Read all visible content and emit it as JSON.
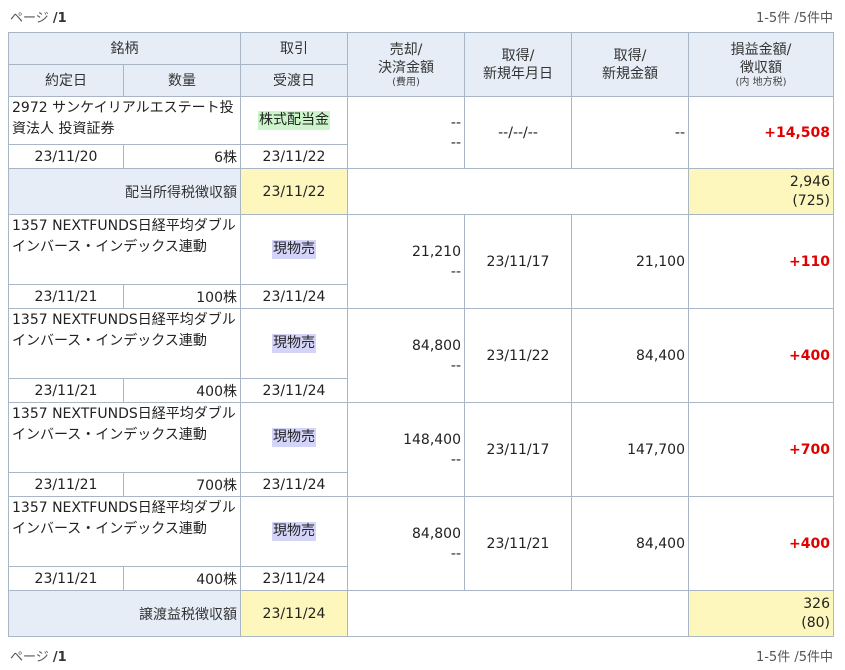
{
  "pager": {
    "page_label": "ページ",
    "page_value": "/1",
    "count_text": "1-5件 /5件中"
  },
  "headers": {
    "meigara": "銘柄",
    "torihiki": "取引",
    "baikyaku_line1": "売却/",
    "baikyaku_line2": "決済金額",
    "baikyaku_sub": "(費用)",
    "shutoku_date_line1": "取得/",
    "shutoku_date_line2": "新規年月日",
    "shutoku_amt_line1": "取得/",
    "shutoku_amt_line2": "新規金額",
    "soneki_line1": "損益金額/",
    "soneki_line2": "徴収額",
    "soneki_sub": "(内 地方税)",
    "yakujo": "約定日",
    "suryo": "数量",
    "ukewatashi": "受渡日"
  },
  "rows": [
    {
      "name": "2972 サンケイリアルエステート投資法人 投資証券",
      "type": "株式配当金",
      "type_kind": "div",
      "sale_amount": "--",
      "sale_fee": "--",
      "acq_date": "--/--/--",
      "acq_amount": "--",
      "profit": "+14,508",
      "trade_date": "23/11/20",
      "qty": "6株",
      "settle_date": "23/11/22"
    },
    {
      "tax_row": true,
      "tax_label": "配当所得税徴収額",
      "tax_date": "23/11/22",
      "tax_amount": "2,946",
      "tax_local": "(725)"
    },
    {
      "name": "1357 NEXTFUNDS日経平均ダブルインバース・インデックス連動",
      "type": "現物売",
      "sale_amount": "21,210",
      "sale_fee": "--",
      "acq_date": "23/11/17",
      "acq_amount": "21,100",
      "profit": "+110",
      "trade_date": "23/11/21",
      "qty": "100株",
      "settle_date": "23/11/24"
    },
    {
      "name": "1357 NEXTFUNDS日経平均ダブルインバース・インデックス連動",
      "type": "現物売",
      "sale_amount": "84,800",
      "sale_fee": "--",
      "acq_date": "23/11/22",
      "acq_amount": "84,400",
      "profit": "+400",
      "trade_date": "23/11/21",
      "qty": "400株",
      "settle_date": "23/11/24"
    },
    {
      "name": "1357 NEXTFUNDS日経平均ダブルインバース・インデックス連動",
      "type": "現物売",
      "sale_amount": "148,400",
      "sale_fee": "--",
      "acq_date": "23/11/17",
      "acq_amount": "147,700",
      "profit": "+700",
      "trade_date": "23/11/21",
      "qty": "700株",
      "settle_date": "23/11/24"
    },
    {
      "name": "1357 NEXTFUNDS日経平均ダブルインバース・インデックス連動",
      "type": "現物売",
      "sale_amount": "84,800",
      "sale_fee": "--",
      "acq_date": "23/11/21",
      "acq_amount": "84,400",
      "profit": "+400",
      "trade_date": "23/11/21",
      "qty": "400株",
      "settle_date": "23/11/24"
    },
    {
      "tax_row": true,
      "tax_label": "譲渡益税徴収額",
      "tax_date": "23/11/24",
      "tax_amount": "326",
      "tax_local": "(80)"
    }
  ],
  "colors": {
    "header_bg": "#e6edf6",
    "border": "#a9b6c6",
    "profit_red": "#e00000",
    "tax_yellow": "#fdf7bd",
    "dividend_tag": "#ccf5cc",
    "sell_tag": "#d4d4f8"
  }
}
